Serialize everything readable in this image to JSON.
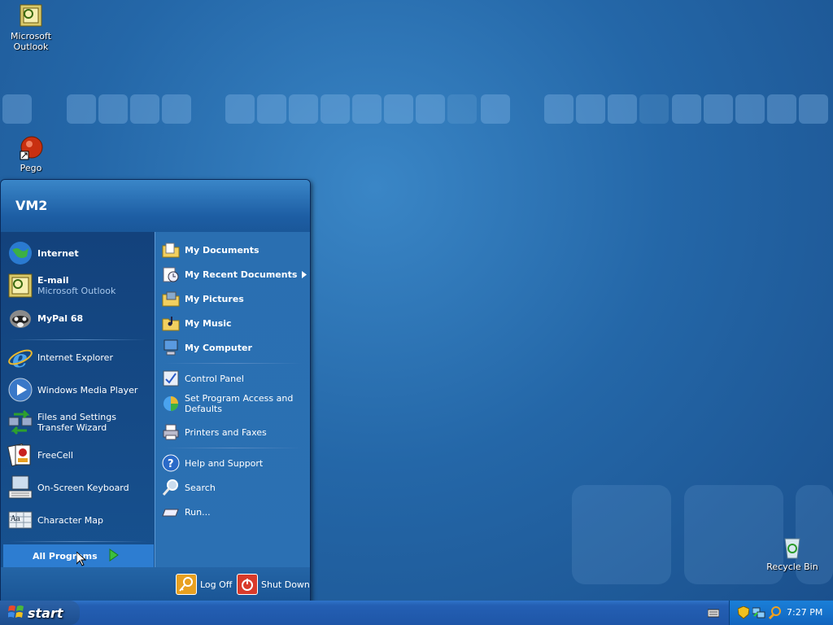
{
  "desktop": {
    "icons": {
      "outlook": "Microsoft Outlook",
      "pego": "Pego",
      "recycle_bin": "Recycle Bin"
    }
  },
  "start_menu": {
    "user": "VM2",
    "pinned": {
      "internet": "Internet",
      "email": "E-mail",
      "email_sub": "Microsoft Outlook",
      "mypal": "MyPal 68"
    },
    "recent": [
      "Internet Explorer",
      "Windows Media Player",
      "Files and Settings Transfer Wizard",
      "FreeCell",
      "On-Screen Keyboard",
      "Character Map"
    ],
    "all_programs": "All Programs",
    "right": {
      "my_documents": "My Documents",
      "my_recent_documents": "My Recent Documents",
      "my_pictures": "My Pictures",
      "my_music": "My Music",
      "my_computer": "My Computer",
      "control_panel": "Control Panel",
      "set_program_access": "Set Program Access and Defaults",
      "printers": "Printers and Faxes",
      "help": "Help and Support",
      "search": "Search",
      "run": "Run..."
    },
    "footer": {
      "log_off": "Log Off",
      "shut_down": "Shut Down"
    }
  },
  "taskbar": {
    "start_label": "start",
    "clock": "7:27 PM"
  },
  "colors": {
    "accent": "#2d7dd1",
    "taskbar": "#245fb3",
    "start_button": "#1c4d8e"
  }
}
